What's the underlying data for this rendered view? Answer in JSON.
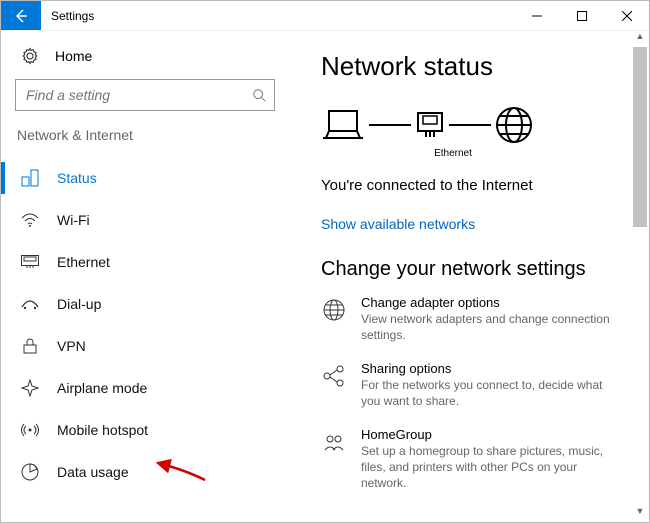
{
  "window": {
    "title": "Settings"
  },
  "sidebar": {
    "home_label": "Home",
    "search_placeholder": "Find a setting",
    "category": "Network & Internet",
    "items": [
      {
        "label": "Status"
      },
      {
        "label": "Wi-Fi"
      },
      {
        "label": "Ethernet"
      },
      {
        "label": "Dial-up"
      },
      {
        "label": "VPN"
      },
      {
        "label": "Airplane mode"
      },
      {
        "label": "Mobile hotspot"
      },
      {
        "label": "Data usage"
      }
    ]
  },
  "main": {
    "heading1": "Network status",
    "diagram_label": "Ethernet",
    "connected_text": "You're connected to the Internet",
    "show_networks": "Show available networks",
    "heading2": "Change your network settings",
    "settings": [
      {
        "label": "Change adapter options",
        "desc": "View network adapters and change connection settings."
      },
      {
        "label": "Sharing options",
        "desc": "For the networks you connect to, decide what you want to share."
      },
      {
        "label": "HomeGroup",
        "desc": "Set up a homegroup to share pictures, music, files, and printers with other PCs on your network."
      }
    ]
  }
}
